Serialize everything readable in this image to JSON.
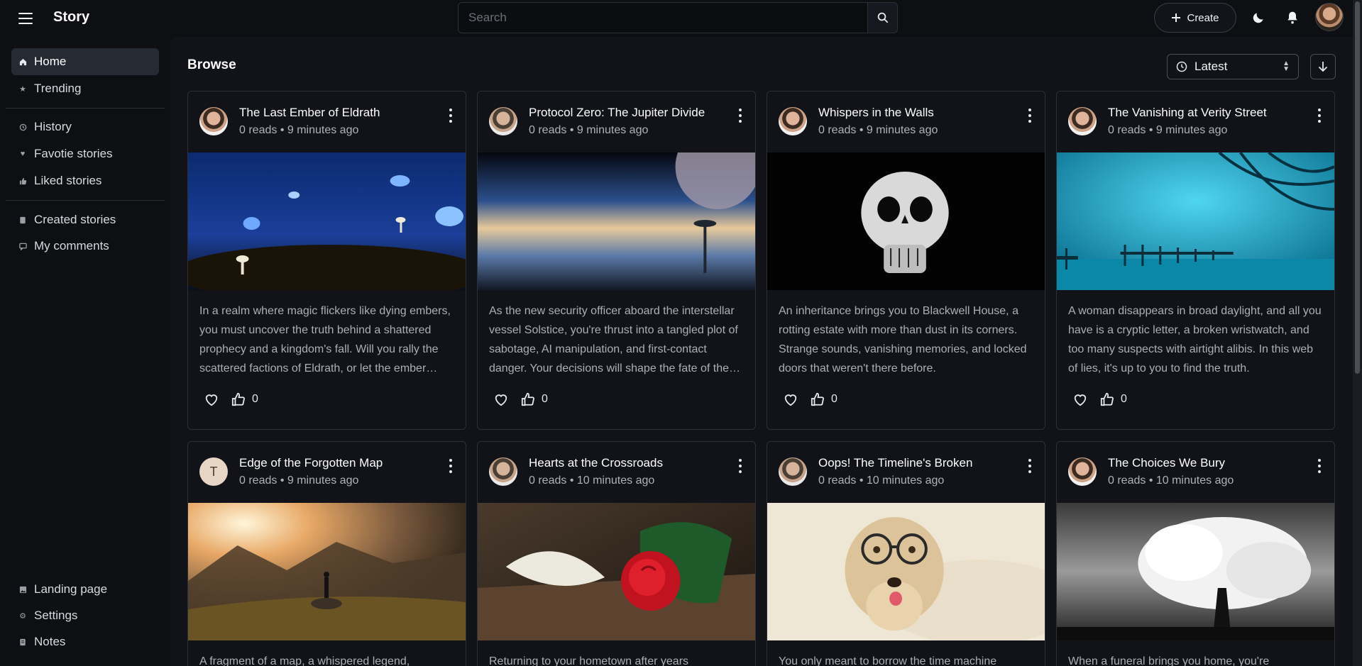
{
  "app": {
    "title": "Story"
  },
  "search": {
    "placeholder": "Search"
  },
  "header": {
    "create_label": "Create"
  },
  "sidebar": {
    "items": [
      {
        "label": "Home",
        "icon": "home-icon"
      },
      {
        "label": "Trending",
        "icon": "star-icon"
      },
      {
        "label": "History",
        "icon": "history-icon"
      },
      {
        "label": "Favotie stories",
        "icon": "heart-icon"
      },
      {
        "label": "Liked stories",
        "icon": "thumbs-up-icon"
      },
      {
        "label": "Created stories",
        "icon": "book-icon"
      },
      {
        "label": "My comments",
        "icon": "comment-icon"
      }
    ],
    "bottom_items": [
      {
        "label": "Landing page",
        "icon": "image-icon"
      },
      {
        "label": "Settings",
        "icon": "gear-icon"
      },
      {
        "label": "Notes",
        "icon": "notes-icon"
      }
    ]
  },
  "main": {
    "title": "Browse",
    "sort": {
      "selected": "Latest"
    },
    "cards": [
      {
        "title": "The Last Ember of Eldrath",
        "meta": "0 reads • 9 minutes ago",
        "description": "In a realm where magic flickers like dying embers, you must uncover the truth behind a shattered prophecy and a kingdom's fall. Will you rally the scattered factions of Eldrath, or let the ember fade?",
        "likes": "0",
        "image": "blue-butterflies-forest"
      },
      {
        "title": "Protocol Zero: The Jupiter Divide",
        "meta": "0 reads • 9 minutes ago",
        "description": "As the new security officer aboard the interstellar vessel Solstice, you're thrust into a tangled plot of sabotage, AI manipulation, and first-contact danger. Your decisions will shape the fate of the crew.",
        "likes": "0",
        "image": "alien-planet-sky"
      },
      {
        "title": "Whispers in the Walls",
        "meta": "0 reads • 9 minutes ago",
        "description": "An inheritance brings you to Blackwell House, a rotting estate with more than dust in its corners. Strange sounds, vanishing memories, and locked doors that weren't there before.",
        "likes": "0",
        "image": "skull"
      },
      {
        "title": "The Vanishing at Verity Street",
        "meta": "0 reads • 9 minutes ago",
        "description": "A woman disappears in broad daylight, and all you have is a cryptic letter, a broken wristwatch, and too many suspects with airtight alibis. In this web of lies, it's up to you to find the truth.",
        "likes": "0",
        "image": "misty-blue-pier"
      },
      {
        "title": "Edge of the Forgotten Map",
        "meta": "0 reads • 9 minutes ago",
        "avatar_letter": "T",
        "description": "A fragment of a map, a whispered legend,",
        "likes": "0",
        "image": "mountain-sunrise"
      },
      {
        "title": "Hearts at the Crossroads",
        "meta": "0 reads • 10 minutes ago",
        "description": "Returning to your hometown after years",
        "likes": "0",
        "image": "red-rose"
      },
      {
        "title": "Oops! The Timeline's Broken",
        "meta": "0 reads • 10 minutes ago",
        "description": "You only meant to borrow the time machine",
        "likes": "0",
        "image": "dog-with-glasses"
      },
      {
        "title": "The Choices We Bury",
        "meta": "0 reads • 10 minutes ago",
        "description": "When a funeral brings you home, you're",
        "likes": "0",
        "image": "white-tree"
      }
    ]
  },
  "colors": {
    "background": "#0d0f13",
    "panel": "#111318",
    "active": "#262a33",
    "text": "#e6e8eb",
    "muted": "#aab0b8"
  }
}
